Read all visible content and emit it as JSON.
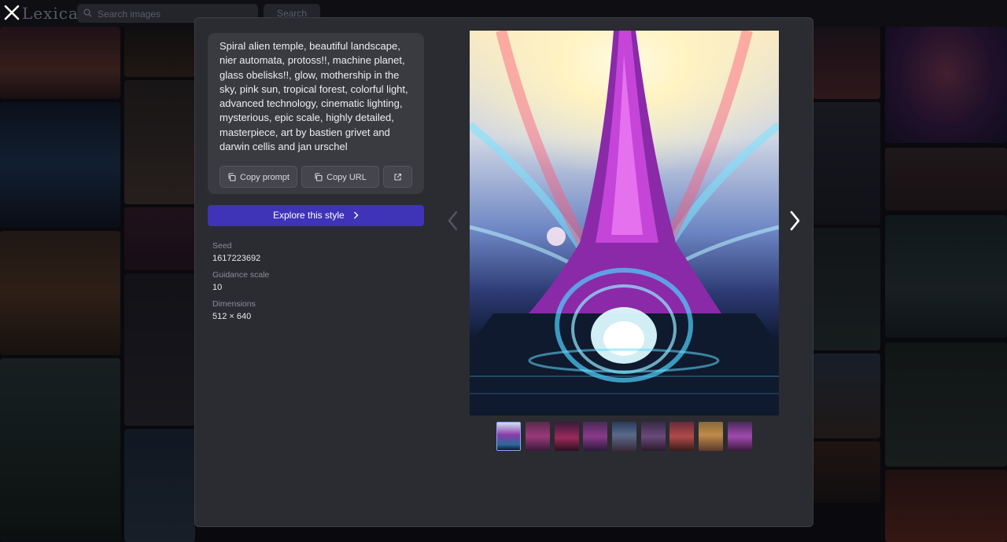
{
  "app": {
    "logo_text": "Lexica",
    "search_placeholder": "Search images",
    "search_button": "Search"
  },
  "prompt": {
    "text": "Spiral alien temple, beautiful landscape, nier automata, protoss!!, machine planet, glass obelisks!!, glow, mothership in the sky, pink sun, tropical forest, colorful light, advanced technology, cinematic lighting, mysterious, epic scale, highly detailed, masterpiece, art by bastien grivet and darwin cellis and jan urschel",
    "copy_prompt_label": "Copy prompt",
    "copy_url_label": "Copy URL"
  },
  "explore_label": "Explore this style",
  "details": [
    {
      "label": "Seed",
      "value": "1617223692"
    },
    {
      "label": "Guidance scale",
      "value": "10"
    },
    {
      "label": "Dimensions",
      "value": "512 × 640"
    }
  ],
  "icons": {
    "close": "close-icon",
    "search": "search-icon",
    "copy": "copy-icon",
    "external": "external-link-icon",
    "chevron": "chevron-right-icon",
    "prev": "chevron-left-icon",
    "next": "chevron-right-icon"
  },
  "colors": {
    "modal_bg": "#2b2c31",
    "card_bg": "#3a3b41",
    "accent": "#3f33b8"
  },
  "thumbnail_count": 9,
  "selected_thumbnail": 1
}
